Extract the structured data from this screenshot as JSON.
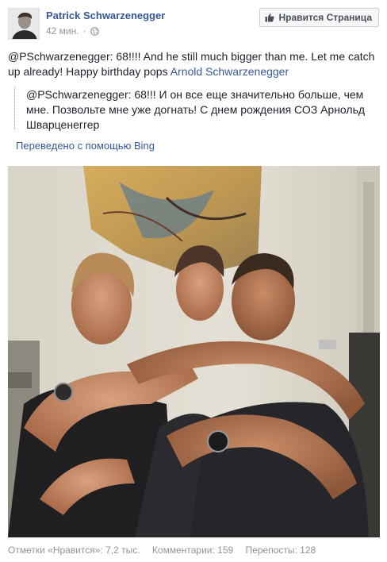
{
  "post": {
    "author": "Patrick Schwarzenegger",
    "time": "42 мин.",
    "separator": "·",
    "like_page_label": "Нравится Страница",
    "text_main": "@PSchwarzenegger: 68!!!! And he still much bigger than me. Let me catch up already! Happy birthday pops ",
    "text_link": "Arnold Schwarzenegger",
    "translation": "@PSchwarzenegger: 68!!! И он все еще значительно больше, чем мне. Позвольте мне уже догнать! С днем рождения СОЗ Арнольд Шварценеггер",
    "translated_by": "Переведено с помощью Bing"
  },
  "stats": {
    "likes": "Отметки «Нравится»: 7,2 тыс.",
    "comments": "Комментарии: 159",
    "shares": "Перепосты: 128"
  },
  "colors": {
    "link": "#365899",
    "meta": "#90949c",
    "button_bg": "#f6f7f9"
  },
  "icons": {
    "globe": "globe-icon",
    "thumb": "thumbs-up-icon"
  }
}
